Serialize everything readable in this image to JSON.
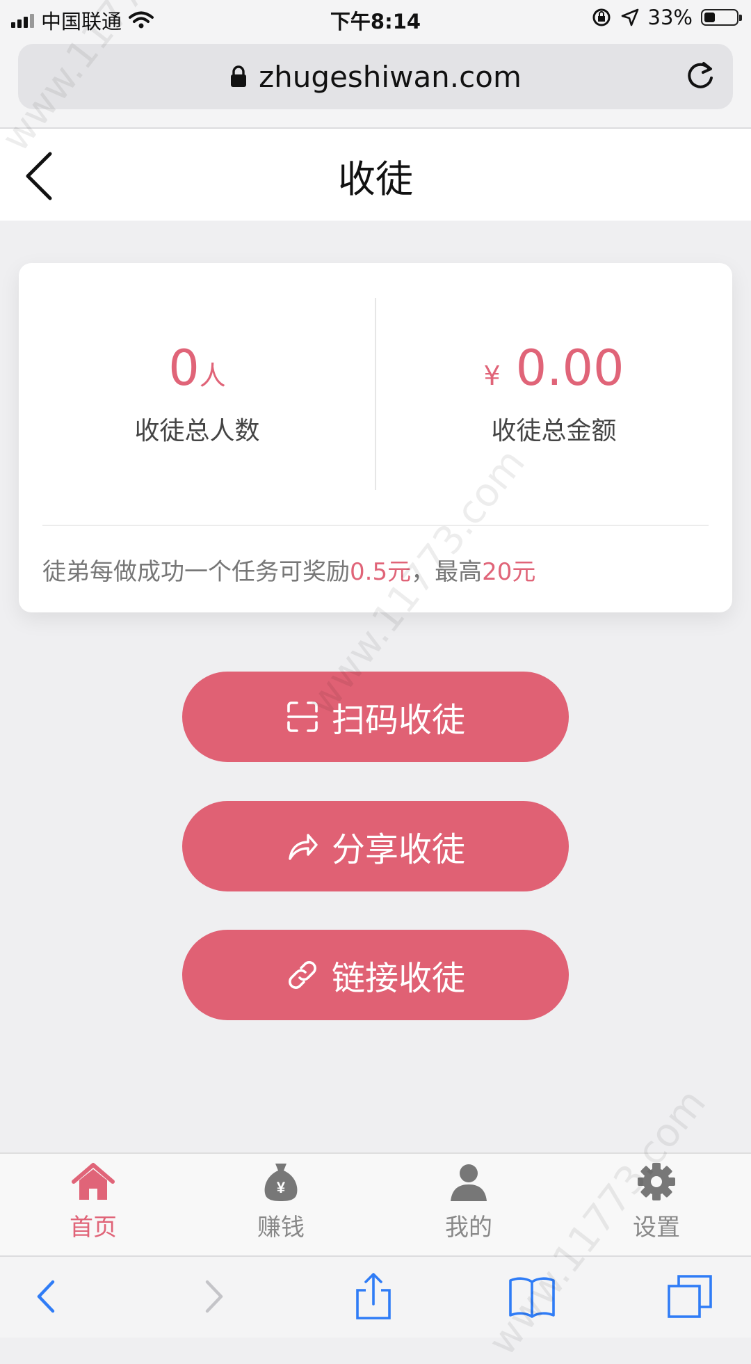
{
  "status_bar": {
    "carrier": "中国联通",
    "time": "下午8:14",
    "battery_percent": "33%",
    "battery_level": 0.33
  },
  "browser": {
    "url": "zhugeshiwan.com"
  },
  "header": {
    "title": "收徒"
  },
  "stats": {
    "count_value": "0",
    "count_unit": "人",
    "count_label": "收徒总人数",
    "amount_currency": "¥",
    "amount_value": "0.00",
    "amount_label": "收徒总金额",
    "reward_prefix": "徒弟每做成功一个任务可奖励",
    "reward_per_task": "0.5元",
    "reward_sep": "，最高",
    "reward_max": "20元"
  },
  "actions": [
    {
      "label": "扫码收徒",
      "icon": "scan-icon"
    },
    {
      "label": "分享收徒",
      "icon": "share-arrow-icon"
    },
    {
      "label": "链接收徒",
      "icon": "link-icon"
    }
  ],
  "tabs": [
    {
      "label": "首页",
      "icon": "home-icon",
      "active": true
    },
    {
      "label": "赚钱",
      "icon": "money-bag-icon",
      "active": false
    },
    {
      "label": "我的",
      "icon": "user-icon",
      "active": false
    },
    {
      "label": "设置",
      "icon": "gear-icon",
      "active": false
    }
  ],
  "watermark": "www.11773.com",
  "colors": {
    "accent": "#e06478",
    "button": "#e06174",
    "background": "#efeff1",
    "ios_blue": "#2f7cf6"
  }
}
